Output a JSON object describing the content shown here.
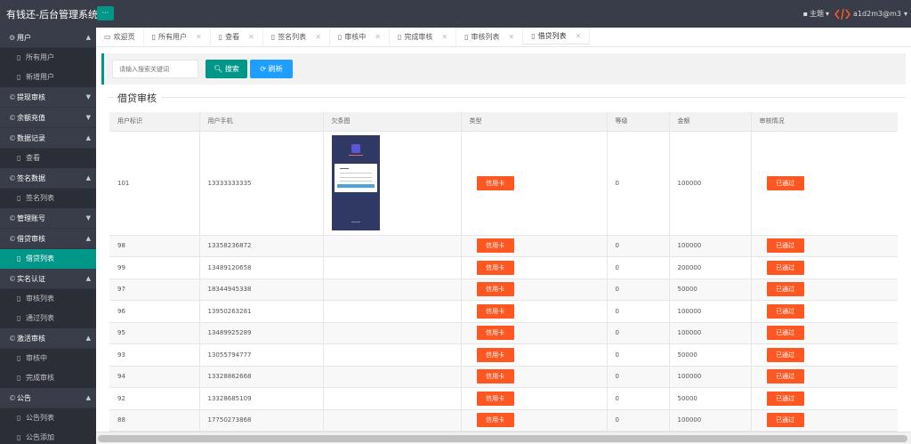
{
  "header": {
    "title": "有钱还-后台管理系统",
    "menu_toggle": "···",
    "theme_label": "主题",
    "user_name": "a1d2m3@m3"
  },
  "sidebar": {
    "groups": [
      {
        "label": "用户",
        "items": [
          "所有用户",
          "新增用户"
        ],
        "expanded": true
      },
      {
        "label": "提现审核",
        "items": [],
        "expanded": false
      },
      {
        "label": "余额充值",
        "items": [],
        "expanded": false
      },
      {
        "label": "数据记录",
        "items": [
          "查看"
        ],
        "expanded": true
      },
      {
        "label": "签名数据",
        "items": [
          "签名列表"
        ],
        "expanded": true
      },
      {
        "label": "管理账号",
        "items": [],
        "expanded": false
      },
      {
        "label": "借贷审核",
        "items": [
          "借贷列表"
        ],
        "expanded": true
      },
      {
        "label": "实名认证",
        "items": [
          "审核列表",
          "通过列表"
        ],
        "expanded": true
      },
      {
        "label": "激活审核",
        "items": [
          "审核中",
          "完成审核"
        ],
        "expanded": true
      },
      {
        "label": "公告",
        "items": [
          "公告列表",
          "公告添加"
        ],
        "expanded": true
      }
    ],
    "active_item": "借贷列表"
  },
  "tabs": [
    {
      "label": "欢迎页",
      "closable": false
    },
    {
      "label": "所有用户",
      "closable": true
    },
    {
      "label": "查看",
      "closable": true
    },
    {
      "label": "签名列表",
      "closable": true
    },
    {
      "label": "审核中",
      "closable": true
    },
    {
      "label": "完成审核",
      "closable": true
    },
    {
      "label": "审核列表",
      "closable": true
    },
    {
      "label": "借贷列表",
      "closable": true
    }
  ],
  "search": {
    "placeholder": "请输入搜索关键词",
    "search_label": "搜索",
    "refresh_label": "刷新"
  },
  "section_title": "借贷审核",
  "table": {
    "headers": [
      "用户标识",
      "用户手机",
      "欠条图",
      "类型",
      "等级",
      "金额",
      "审核情况"
    ],
    "rows": [
      {
        "id": "101",
        "phone": "13333333335",
        "has_image": true,
        "type": "信用卡",
        "level": "0",
        "amount": "100000",
        "status": "已通过"
      },
      {
        "id": "98",
        "phone": "13358236872",
        "has_image": false,
        "type": "信用卡",
        "level": "0",
        "amount": "100000",
        "status": "已通过"
      },
      {
        "id": "99",
        "phone": "13489120658",
        "has_image": false,
        "type": "信用卡",
        "level": "0",
        "amount": "200000",
        "status": "已通过"
      },
      {
        "id": "97",
        "phone": "18344945338",
        "has_image": false,
        "type": "信用卡",
        "level": "0",
        "amount": "50000",
        "status": "已通过"
      },
      {
        "id": "96",
        "phone": "13950263281",
        "has_image": false,
        "type": "信用卡",
        "level": "0",
        "amount": "100000",
        "status": "已通过"
      },
      {
        "id": "95",
        "phone": "13489925289",
        "has_image": false,
        "type": "信用卡",
        "level": "0",
        "amount": "100000",
        "status": "已通过"
      },
      {
        "id": "93",
        "phone": "13055794777",
        "has_image": false,
        "type": "信用卡",
        "level": "0",
        "amount": "50000",
        "status": "已通过"
      },
      {
        "id": "94",
        "phone": "13328862668",
        "has_image": false,
        "type": "信用卡",
        "level": "0",
        "amount": "100000",
        "status": "已通过"
      },
      {
        "id": "92",
        "phone": "13328685109",
        "has_image": false,
        "type": "信用卡",
        "level": "0",
        "amount": "50000",
        "status": "已通过"
      },
      {
        "id": "88",
        "phone": "17750273868",
        "has_image": false,
        "type": "信用卡",
        "level": "0",
        "amount": "100000",
        "status": "已通过"
      }
    ]
  },
  "colors": {
    "header_bg": "#393d49",
    "accent": "#009688",
    "refresh": "#1e9fff",
    "tag": "#ff5722"
  }
}
